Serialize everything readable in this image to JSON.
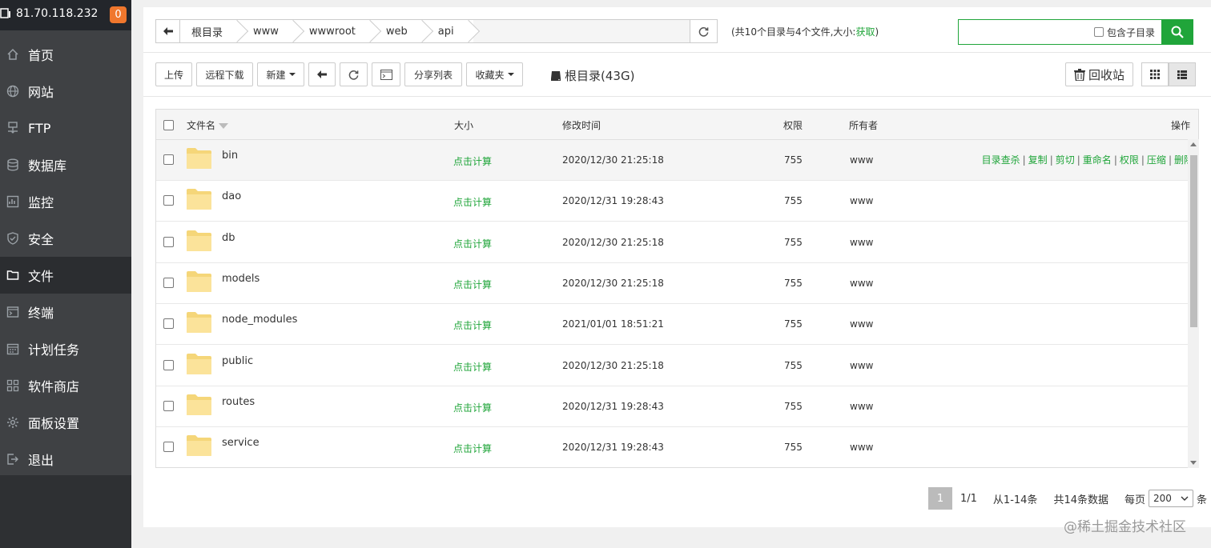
{
  "server": {
    "ip": "81.70.118.232",
    "badge": "0"
  },
  "nav": [
    {
      "label": "首页",
      "icon": "home-icon"
    },
    {
      "label": "网站",
      "icon": "globe-icon"
    },
    {
      "label": "FTP",
      "icon": "ftp-icon"
    },
    {
      "label": "数据库",
      "icon": "database-icon"
    },
    {
      "label": "监控",
      "icon": "monitor-icon"
    },
    {
      "label": "安全",
      "icon": "shield-icon"
    },
    {
      "label": "文件",
      "icon": "folder-icon",
      "active": true
    },
    {
      "label": "终端",
      "icon": "terminal-icon"
    },
    {
      "label": "计划任务",
      "icon": "calendar-icon"
    },
    {
      "label": "软件商店",
      "icon": "apps-icon"
    },
    {
      "label": "面板设置",
      "icon": "gear-icon"
    },
    {
      "label": "退出",
      "icon": "logout-icon"
    }
  ],
  "breadcrumb": [
    "根目录",
    "www",
    "wwwroot",
    "web",
    "api"
  ],
  "summary": {
    "text": "(共10个目录与4个文件,大小:",
    "link": "获取",
    "close": ")"
  },
  "search": {
    "placeholder": "",
    "subdir_label": "包含子目录"
  },
  "toolbar": {
    "upload": "上传",
    "remote_download": "远程下载",
    "new": "新建",
    "share_list": "分享列表",
    "favorites": "收藏夹"
  },
  "root_dir": "根目录(43G)",
  "recycle": "回收站",
  "table": {
    "headers": {
      "name": "文件名",
      "size": "大小",
      "mtime": "修改时间",
      "perm": "权限",
      "owner": "所有者",
      "ops": "操作"
    },
    "rows": [
      {
        "name": "bin",
        "size": "点击计算",
        "mtime": "2020/12/30 21:25:18",
        "perm": "755",
        "owner": "www"
      },
      {
        "name": "dao",
        "size": "点击计算",
        "mtime": "2020/12/31 19:28:43",
        "perm": "755",
        "owner": "www"
      },
      {
        "name": "db",
        "size": "点击计算",
        "mtime": "2020/12/30 21:25:18",
        "perm": "755",
        "owner": "www"
      },
      {
        "name": "models",
        "size": "点击计算",
        "mtime": "2020/12/30 21:25:18",
        "perm": "755",
        "owner": "www"
      },
      {
        "name": "node_modules",
        "size": "点击计算",
        "mtime": "2021/01/01 18:51:21",
        "perm": "755",
        "owner": "www"
      },
      {
        "name": "public",
        "size": "点击计算",
        "mtime": "2020/12/30 21:25:18",
        "perm": "755",
        "owner": "www"
      },
      {
        "name": "routes",
        "size": "点击计算",
        "mtime": "2020/12/31 19:28:43",
        "perm": "755",
        "owner": "www"
      },
      {
        "name": "service",
        "size": "点击计算",
        "mtime": "2020/12/31 19:28:43",
        "perm": "755",
        "owner": "www"
      }
    ],
    "row_ops": [
      "目录查杀",
      "复制",
      "剪切",
      "重命名",
      "权限",
      "压缩",
      "删除"
    ]
  },
  "pager": {
    "current": "1",
    "pages": "1/1",
    "range": "从1-14条",
    "total": "共14条数据",
    "per_page_label": "每页",
    "per_page": "200",
    "unit": "条"
  },
  "watermark": "@稀土掘金技术社区",
  "colors": {
    "accent": "#20a53a",
    "sidebar": "#3f4144",
    "badge": "#f0772d"
  }
}
